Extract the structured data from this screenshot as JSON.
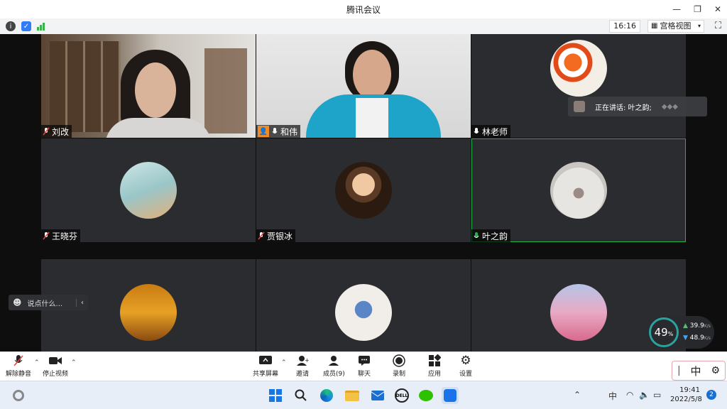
{
  "window": {
    "title": "腾讯会议"
  },
  "infobar": {
    "time": "16:16",
    "view_label": "宫格视图"
  },
  "participants": [
    {
      "name": "刘改"
    },
    {
      "name": "和伟"
    },
    {
      "name": "林老师"
    },
    {
      "name": "王晓芬"
    },
    {
      "name": "贾银冰"
    },
    {
      "name": "叶之韵"
    },
    {
      "name": ""
    },
    {
      "name": ""
    },
    {
      "name": ""
    }
  ],
  "speaking": {
    "label": "正在讲话: 叶之韵;"
  },
  "chat": {
    "placeholder": "说点什么..."
  },
  "netmeter": {
    "cpu": "49",
    "cpu_unit": "%",
    "up": "39.9",
    "down": "48.9",
    "rate_unit": "K/s"
  },
  "toolbar": {
    "unmute": "解除静音",
    "stop_video": "停止视频",
    "share": "共享屏幕",
    "invite": "邀请",
    "members": "成员(9)",
    "chat": "聊天",
    "record": "录制",
    "apps": "应用",
    "settings": "设置"
  },
  "ime": {
    "lang": "中"
  },
  "taskbar": {
    "lang": "中",
    "time": "19:41",
    "date": "2022/5/8",
    "notif_count": "2"
  },
  "colors": {
    "active_speaker": "#23b14d",
    "accent": "#1a73e8"
  }
}
